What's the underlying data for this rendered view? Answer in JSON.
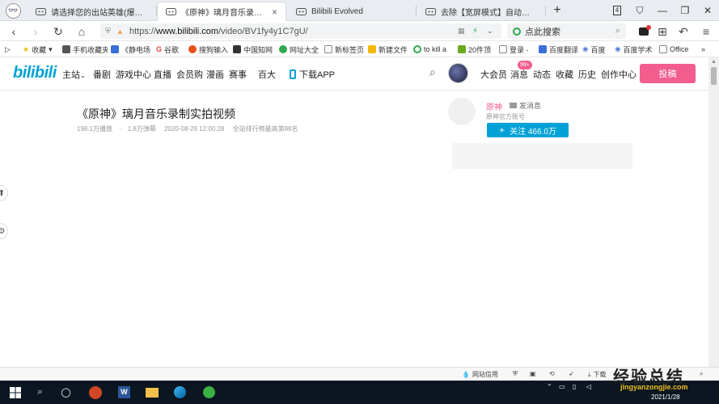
{
  "tabs": [
    {
      "title": "请选择您的出站英雄(爆笑沙雕动",
      "active": false
    },
    {
      "title": "《原神》璃月音乐录制实拍视频",
      "active": true
    },
    {
      "title": "Bilibili Evolved",
      "active": false
    },
    {
      "title": "去除【宽屏模式】自动调节网页",
      "active": false
    }
  ],
  "tab_close": "×",
  "new_tab": "+",
  "tab_count": "4",
  "address": {
    "url_prefix": "https://",
    "url_host": "www.bilibili.com",
    "url_path": "/video/BV1fy4y1C7gU/",
    "search_placeholder": "点此搜索"
  },
  "bookmarks": [
    {
      "label": "收藏",
      "icon_color": "#f5b800"
    },
    {
      "label": "手机收藏夹",
      "icon_color": "#555555"
    },
    {
      "label": "《静电场",
      "icon_color": "#3b6fd8"
    },
    {
      "label": "谷歌",
      "icon_color": "#db4437"
    },
    {
      "label": "搜狗输入",
      "icon_color": "#e8501a"
    },
    {
      "label": "中国知网",
      "icon_color": "#333333"
    },
    {
      "label": "网址大全",
      "icon_color": "#2fa84f"
    },
    {
      "label": "新标签页",
      "icon_color": "#888888"
    },
    {
      "label": "新建文件",
      "icon_color": "#f2b705"
    },
    {
      "label": "to kill a",
      "icon_color": "#2fa84f"
    },
    {
      "label": "20件顶",
      "icon_color": "#6aaa1e"
    },
    {
      "label": "登录 -",
      "icon_color": "#888888"
    },
    {
      "label": "百度翻译",
      "icon_color": "#3b6fd8"
    },
    {
      "label": "百度",
      "icon_color": "#2f5fd8"
    },
    {
      "label": "百度学术",
      "icon_color": "#2f5fd8"
    },
    {
      "label": "Office",
      "icon_color": "#888888"
    }
  ],
  "bili": {
    "logo": "bilibili",
    "nav": [
      "主站",
      "番剧",
      "游戏中心",
      "直播",
      "会员购",
      "漫画",
      "赛事",
      "百大"
    ],
    "download": "下载APP",
    "right_nav": [
      "大会员",
      "消息",
      "动态",
      "收藏",
      "历史",
      "创作中心"
    ],
    "badge": "99+",
    "upload": "投稿"
  },
  "video": {
    "title": "《原神》璃月音乐录制实拍视频",
    "plays": "198.1万播放",
    "danmaku": "1.6万弹幕",
    "date": "2020-08-29 12:00:28",
    "rank": "全站排行榜最高第88名"
  },
  "uploader": {
    "name": "原神",
    "message": "发消息",
    "desc": "原神官方账号",
    "follow": "关注 466.0万"
  },
  "status": {
    "site_trust": "网站信用",
    "download": "下载"
  },
  "taskbar": {
    "time": "2021/1/28"
  },
  "watermark": {
    "text": "经验总结",
    "url": "jingyanzongjie.com"
  },
  "colors": {
    "bili_blue": "#00a1d6",
    "bili_pink": "#f25d8e",
    "taskbar": "#0b1621"
  }
}
